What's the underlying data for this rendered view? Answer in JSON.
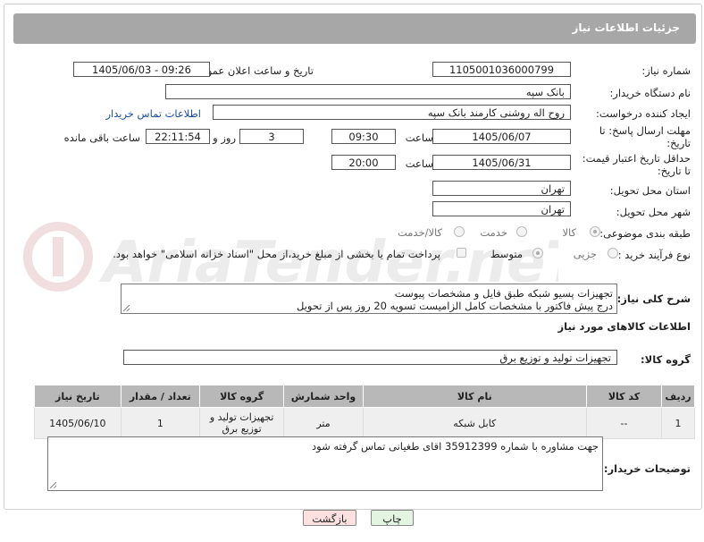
{
  "header": {
    "title": "جزئیات اطلاعات نیاز"
  },
  "fields": {
    "need_number_label": "شماره نیاز:",
    "need_number": "1105001036000799",
    "announce_label": "تاریخ و ساعت اعلان عمومی:",
    "announce_value": "1405/06/03 - 09:26",
    "buyer_org_label": "نام دستگاه خریدار:",
    "buyer_org": "بانک سپه",
    "creator_label": "ایجاد کننده درخواست:",
    "creator": "روح اله روشنی کارمند بانک سپه",
    "contact_link": "اطلاعات تماس خریدار",
    "deadline_label": "مهلت ارسال پاسخ: تا تاریخ:",
    "deadline_date": "1405/06/07",
    "time_label": "ساعت",
    "deadline_time": "09:30",
    "days_value": "3",
    "days_label": "روز و",
    "remaining_time": "22:11:54",
    "remaining_label": "ساعت باقی مانده",
    "price_valid_label": "حداقل تاریخ اعتبار قیمت: تا تاریخ:",
    "price_valid_date": "1405/06/31",
    "price_valid_time": "20:00",
    "province_label": "استان محل تحویل:",
    "province": "تهران",
    "city_label": "شهر محل تحویل:",
    "city": "تهران",
    "category_label": "طبقه بندی موضوعی:",
    "category_options": [
      "کالا",
      "خدمت",
      "کالا/خدمت"
    ],
    "process_label": "نوع فرآیند خرید :",
    "process_options": [
      "جزیی",
      "متوسط"
    ],
    "payment_note": "پرداخت تمام یا بخشی از مبلغ خرید،از محل \"اسناد خزانه اسلامی\" خواهد بود.",
    "summary_label": "شرح کلی نیاز:",
    "summary_line1": "تجهیزات پسیو شبکه طبق فایل و مشخصات پیوست",
    "summary_line2": "درج پیش فاکتور با مشخصات کامل الزامیست تسویه 20 روز پس از تحویل",
    "goods_info_title": "اطلاعات کالاهای مورد نیاز",
    "goods_group_label": "گروه کالا:",
    "goods_group": "تجهیزات تولید و توزیع برق",
    "buyer_notes_label": "توضیحات خریدار:",
    "buyer_notes": "جهت مشاوره با شماره 35912399 اقای طغیانی تماس گرفته شود"
  },
  "table": {
    "headers": [
      "ردیف",
      "کد کالا",
      "نام کالا",
      "واحد شمارش",
      "گروه کالا",
      "تعداد / مقدار",
      "تاریخ نیاز"
    ],
    "rows": [
      {
        "row": "1",
        "code": "--",
        "name": "کابل شبکه",
        "unit": "متر",
        "group_l1": "تجهیزات تولید و",
        "group_l2": "توزیع برق",
        "qty": "1",
        "date": "1405/06/10"
      }
    ]
  },
  "buttons": {
    "print": "چاپ",
    "back": "بازگشت"
  },
  "watermark": "AriaTender.neT",
  "colors": {
    "header_bg": "#a7a7a7",
    "link": "#1a4f9c",
    "back_bg": "#fde0e0",
    "print_bg": "#e3f4e1"
  }
}
